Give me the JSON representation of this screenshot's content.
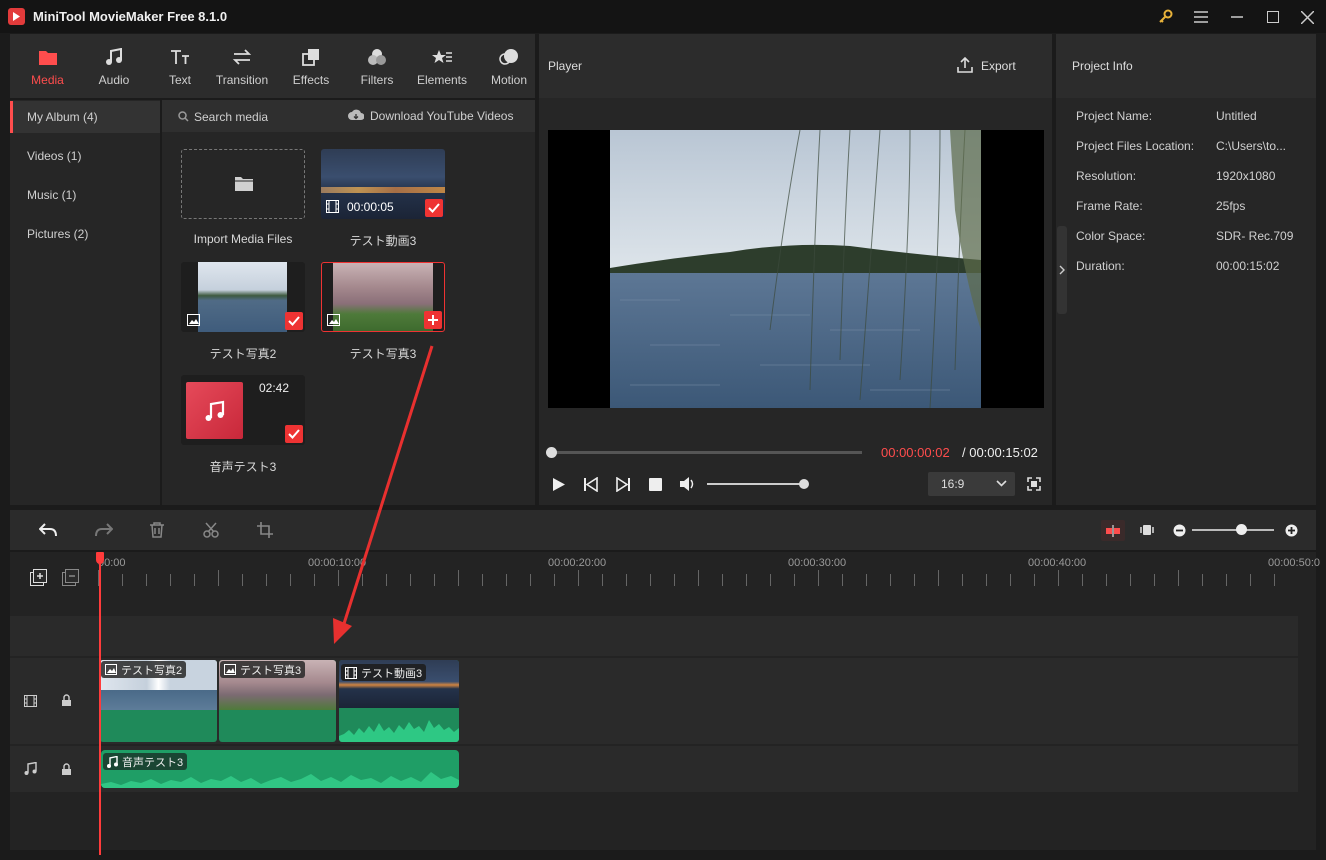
{
  "window": {
    "title": "MiniTool MovieMaker Free 8.1.0"
  },
  "toolbar": {
    "items": [
      {
        "label": "Media",
        "icon": "folder-icon",
        "active": true
      },
      {
        "label": "Audio",
        "icon": "music-icon"
      },
      {
        "label": "Text",
        "icon": "text-icon"
      },
      {
        "label": "Transition",
        "icon": "transition-icon"
      },
      {
        "label": "Effects",
        "icon": "effects-icon"
      },
      {
        "label": "Filters",
        "icon": "filters-icon"
      },
      {
        "label": "Elements",
        "icon": "elements-icon"
      },
      {
        "label": "Motion",
        "icon": "motion-icon"
      }
    ]
  },
  "sidebar": {
    "items": [
      {
        "label": "My Album (4)",
        "selected": true
      },
      {
        "label": "Videos (1)"
      },
      {
        "label": "Music (1)"
      },
      {
        "label": "Pictures (2)"
      }
    ]
  },
  "media": {
    "search_label": "Search media",
    "download_label": "Download YouTube Videos",
    "import_label": "Import Media Files",
    "items": [
      {
        "name": "テスト動画3",
        "duration": "00:00:05",
        "kind": "video",
        "added": true
      },
      {
        "name": "テスト写真2",
        "kind": "picture",
        "added": true
      },
      {
        "name": "テスト写真3",
        "kind": "picture",
        "added": false
      },
      {
        "name": "音声テスト3",
        "duration": "02:42",
        "kind": "audio",
        "added": true
      }
    ]
  },
  "player": {
    "title": "Player",
    "export_label": "Export",
    "current_time": "00:00:00:02",
    "total_time": "/ 00:00:15:02",
    "aspect": "16:9",
    "volume": 0.82,
    "progress": 0.01
  },
  "project_info": {
    "title": "Project Info",
    "rows": [
      {
        "label": "Project Name:",
        "value": "Untitled"
      },
      {
        "label": "Project Files Location:",
        "value": "C:\\Users\\to..."
      },
      {
        "label": "Resolution:",
        "value": "1920x1080"
      },
      {
        "label": "Frame Rate:",
        "value": "25fps"
      },
      {
        "label": "Color Space:",
        "value": "SDR- Rec.709"
      },
      {
        "label": "Duration:",
        "value": "00:00:15:02"
      }
    ]
  },
  "timeline": {
    "ruler": [
      "00:00",
      "00:00:10:00",
      "00:00:20:00",
      "00:00:30:00",
      "00:00:40:00",
      "00:00:50:0"
    ],
    "video_clips": [
      "テスト写真2",
      "テスト写真3",
      "テスト動画3"
    ],
    "audio_clips": [
      "音声テスト3"
    ],
    "zoom": 0.6
  },
  "colors": {
    "accent": "#ff4d4d",
    "clip_green": "#1f8a5a",
    "audio_green": "#26b574"
  }
}
